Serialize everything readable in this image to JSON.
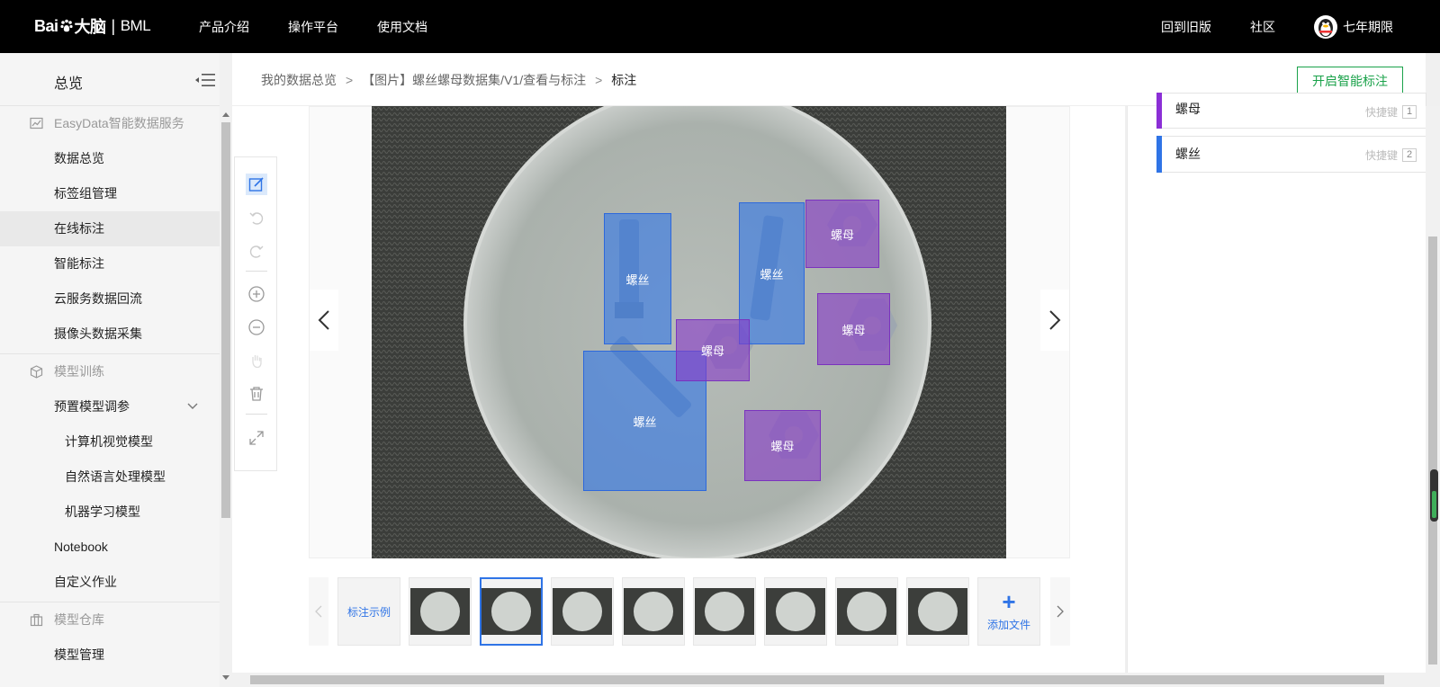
{
  "topbar": {
    "logo_bai": "Bai",
    "logo_du": "大脑",
    "logo_sep": "|",
    "logo_bml": "BML",
    "nav": [
      "产品介绍",
      "操作平台",
      "使用文档"
    ],
    "back_old": "回到旧版",
    "community": "社区",
    "username": "七年期限"
  },
  "sidebar": {
    "title": "总览",
    "groups": {
      "easydata": "EasyData智能数据服务",
      "training": "模型训练",
      "warehouse": "模型仓库"
    },
    "items": {
      "data_overview": "数据总览",
      "tag_group": "标签组管理",
      "online_label": "在线标注",
      "smart_label": "智能标注",
      "cloud_return": "云服务数据回流",
      "camera": "摄像头数据采集",
      "preset_tuning": "预置模型调参",
      "cv_model": "计算机视觉模型",
      "nlp_model": "自然语言处理模型",
      "ml_model": "机器学习模型",
      "notebook": "Notebook",
      "custom_job": "自定义作业",
      "model_mgmt": "模型管理"
    }
  },
  "breadcrumb": {
    "root": "我的数据总览",
    "dataset": "【图片】螺丝螺母数据集/V1/查看与标注",
    "current": "标注"
  },
  "smart_button": "开启智能标注",
  "labels": [
    {
      "name": "螺母",
      "hotkey_label": "快捷键",
      "key": "1",
      "color": "#8b2fd6"
    },
    {
      "name": "螺丝",
      "hotkey_label": "快捷键",
      "key": "2",
      "color": "#2f74e6"
    }
  ],
  "annotations": {
    "screw": "螺丝",
    "nut": "螺母"
  },
  "thumbstrip": {
    "example": "标注示例",
    "add_file": "添加文件"
  }
}
